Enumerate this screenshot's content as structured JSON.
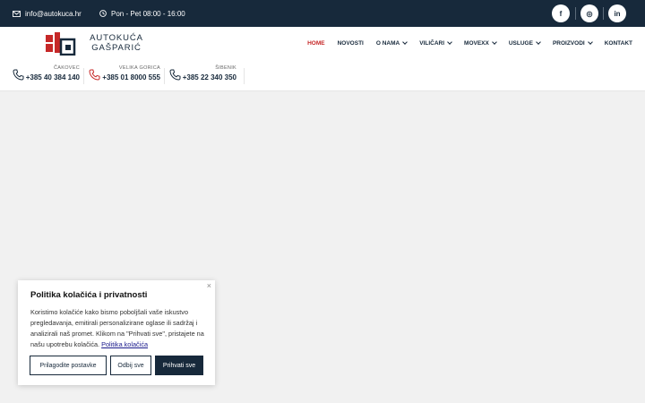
{
  "topbar": {
    "email": "info@autokuca.hr",
    "hours": "Pon - Pet 08:00 - 16:00",
    "social": {
      "facebook": "f",
      "instagram": "◎",
      "linkedin": "in"
    },
    "bg_color": "#17293b"
  },
  "logo": {
    "line1": "AUTOKUĆA",
    "line2": "GAŠPARIĆ"
  },
  "nav": {
    "items": [
      {
        "label": "HOME",
        "active": true,
        "dropdown": false
      },
      {
        "label": "NOVOSTI",
        "dropdown": false
      },
      {
        "label": "O NAMA",
        "dropdown": true
      },
      {
        "label": "VILIČARI",
        "dropdown": true
      },
      {
        "label": "MOVEXX",
        "dropdown": true
      },
      {
        "label": "USLUGE",
        "dropdown": true
      },
      {
        "label": "PROIZVODI",
        "dropdown": true
      },
      {
        "label": "KONTAKT",
        "dropdown": false
      }
    ],
    "active_color": "#c62828"
  },
  "contacts": [
    {
      "city": "ČAKOVEC",
      "phone": "+385 40 384 140"
    },
    {
      "city": "VELIKA GORICA",
      "phone": "+385 01 8000 555"
    },
    {
      "city": "ŠIBENIK",
      "phone": "+385 22 340 350"
    }
  ],
  "cookie": {
    "title": "Politika kolačića i privatnosti",
    "body": "Koristimo kolačiće kako bismo poboljšali vaše iskustvo pregledavanja, emitirali personalizirane oglase ili sadržaj i analizirali naš promet. Klikom na \"Prihvati sve\", pristajete na našu upotrebu kolačića. ",
    "link": "Politika kolačića",
    "buttons": {
      "customize": "Prilagodite postavke",
      "reject": "Odbij sve",
      "accept": "Prihvati sve"
    },
    "close": "×"
  }
}
